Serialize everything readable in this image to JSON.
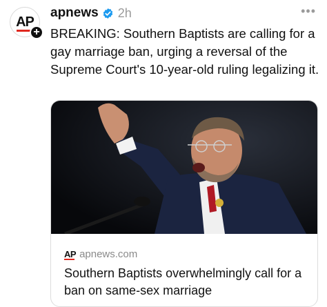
{
  "post": {
    "avatar_text": "AP",
    "username": "apnews",
    "time": "2h",
    "more": "•••",
    "text": "BREAKING: Southern Baptists are calling for a gay marriage ban, urging a reversal of the Supreme Court's 10-year-old ruling legalizing it.",
    "follow_symbol": "+"
  },
  "link_card": {
    "logo_text": "AP",
    "domain": "apnews.com",
    "title": "Southern Baptists overwhelmingly call for a ban on same-sex marriage"
  },
  "colors": {
    "verified": "#1d9bf0",
    "ap_red": "#e0281f",
    "muted": "#9a9a9a"
  }
}
